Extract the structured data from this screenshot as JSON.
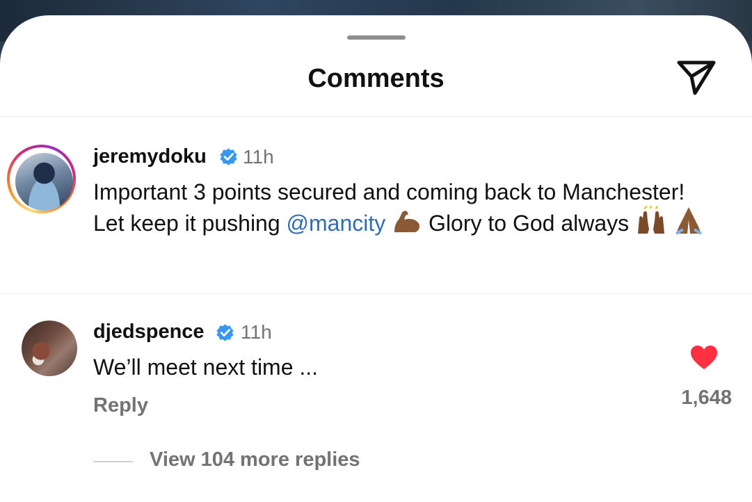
{
  "sheet": {
    "title": "Comments",
    "share_icon": "paper-plane-icon"
  },
  "comments": [
    {
      "username": "jeremydoku",
      "verified": true,
      "time": "11h",
      "text_before": "Important 3 points secured and coming back to Manchester! Let keep it pushing ",
      "mention": "@mancity",
      "text_after": " Glory to God always ",
      "emojis": [
        "flexed-biceps-emoji",
        "raising-hands-emoji",
        "folded-hands-emoji"
      ],
      "has_story_ring": true
    },
    {
      "username": "djedspence",
      "verified": true,
      "time": "11h",
      "text": "We’ll meet next time ...",
      "reply_label": "Reply",
      "likes": "1,648",
      "liked": true,
      "view_replies_label": "View 104 more replies"
    }
  ],
  "colors": {
    "mention": "#2f6cb3",
    "verified": "#3897f0",
    "heart": "#ff3040",
    "muted_text": "#737373"
  }
}
